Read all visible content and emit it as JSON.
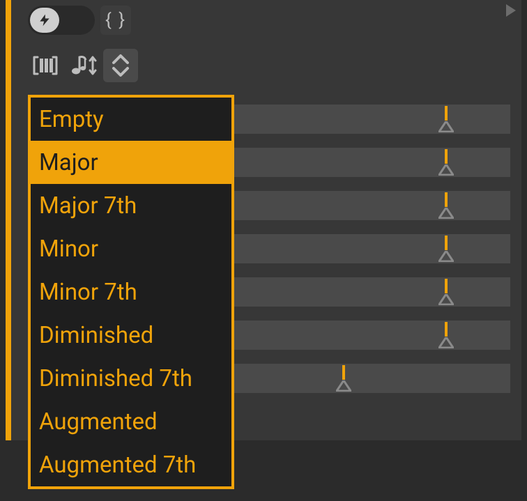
{
  "colors": {
    "accent": "#f0a30a",
    "panel": "#373737",
    "menu_bg": "#1e1e1e"
  },
  "icons": {
    "bolt": "bolt-icon",
    "braces": "{ }",
    "piano": "piano-bracket-icon",
    "note_updown": "note-updown-icon",
    "chevrons": "chevrons-up-down-icon",
    "play": "play-icon"
  },
  "sliders": [
    {
      "value": 0.863
    },
    {
      "value": 0.863
    },
    {
      "value": 0.863
    },
    {
      "value": 0.863
    },
    {
      "value": 0.863
    },
    {
      "value": 0.863
    },
    {
      "value": 0.645
    }
  ],
  "menu": {
    "selected_index": 1,
    "items": [
      "Empty",
      "Major",
      "Major 7th",
      "Minor",
      "Minor 7th",
      "Diminished",
      "Diminished 7th",
      "Augmented",
      "Augmented 7th"
    ]
  }
}
